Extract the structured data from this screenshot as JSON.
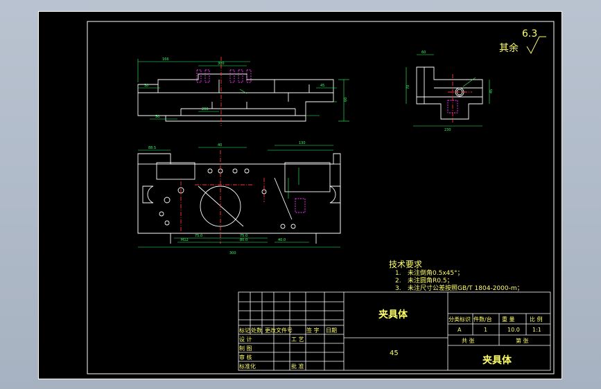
{
  "roughness": {
    "value": "6.3",
    "prefix": "其余"
  },
  "notes": {
    "heading": "技术要求",
    "items": [
      {
        "num": "1.",
        "text": "未注倒角0.5x45°；"
      },
      {
        "num": "2.",
        "text": "未注圆角R0.5；"
      },
      {
        "num": "3.",
        "text": "未注尺寸公差按照GB/T 1804-2000-m；"
      }
    ]
  },
  "title_block": {
    "part_name": "夹具体",
    "material": "45",
    "drawing_title": "夹具体",
    "rev_headers": [
      "标记",
      "处数",
      "更改文件号",
      "签 字",
      "日期"
    ],
    "sign_rows": [
      {
        "role": "设 计",
        "dept": "工 艺"
      },
      {
        "role": "制 图",
        "dept": ""
      },
      {
        "role": "审 核",
        "dept": ""
      },
      {
        "role": "标准化",
        "dept": "批 准"
      }
    ],
    "info_headers": [
      "分类标识",
      "件数/台",
      "重 量",
      "比 例"
    ],
    "info_values": [
      "A",
      "1",
      "10.0",
      "1:1"
    ],
    "sheet_labels": [
      "共 张",
      "第 张"
    ]
  },
  "colors": {
    "outline": "#ffffff",
    "dimension": "#33ff66",
    "centerline": "#ff3333",
    "hidden": "#ff33ff",
    "annotation": "#ffff66"
  }
}
